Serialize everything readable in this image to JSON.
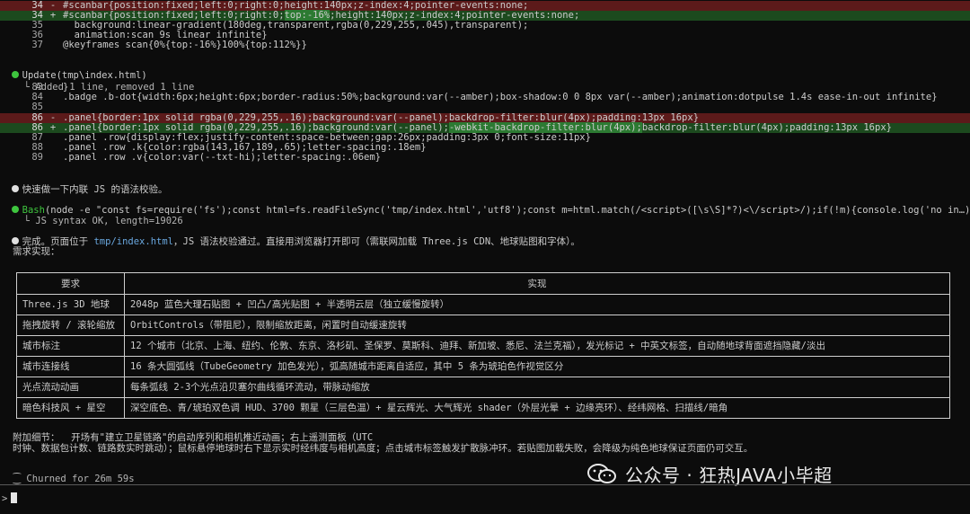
{
  "diff1": [
    {
      "num": "34",
      "sign": "-",
      "type": "del",
      "text": "#scanbar{position:fixed;left:0;right:0;height:140px;z-index:4;pointer-events:none;"
    },
    {
      "num": "34",
      "sign": "+",
      "type": "add",
      "pre": "#scanbar{position:fixed;left:0;right:0;",
      "hl": "top:-16%",
      "post": ";height:140px;z-index:4;pointer-events:none;"
    },
    {
      "num": "35",
      "sign": "",
      "type": "ctx",
      "text": "  background:linear-gradient(180deg,transparent,rgba(0,229,255,.045),transparent);"
    },
    {
      "num": "36",
      "sign": "",
      "type": "ctx",
      "text": "  animation:scan 9s linear infinite}"
    },
    {
      "num": "37",
      "sign": "",
      "type": "ctx",
      "text": "@keyframes scan{0%{top:-16%}100%{top:112%}}"
    }
  ],
  "update": {
    "title": "Update(tmp\\index.html)",
    "summary": "Added 1 line, removed 1 line"
  },
  "diff2": [
    {
      "num": "83",
      "sign": "",
      "type": "ctx",
      "text": "}"
    },
    {
      "num": "84",
      "sign": "",
      "type": "ctx",
      "text": ".badge .b-dot{width:6px;height:6px;border-radius:50%;background:var(--amber);box-shadow:0 0 8px var(--amber);animation:dotpulse 1.4s ease-in-out infinite}"
    },
    {
      "num": "85",
      "sign": "",
      "type": "ctx",
      "text": ""
    },
    {
      "num": "86",
      "sign": "-",
      "type": "del",
      "text": ".panel{border:1px solid rgba(0,229,255,.16);background:var(--panel);backdrop-filter:blur(4px);padding:13px 16px}"
    },
    {
      "num": "86",
      "sign": "+",
      "type": "add",
      "pre": ".panel{border:1px solid rgba(0,229,255,.16);background:var(--panel);",
      "hl": "-webkit-backdrop-filter:blur(4px);",
      "post": "backdrop-filter:blur(4px);padding:13px 16px}"
    },
    {
      "num": "87",
      "sign": "",
      "type": "ctx",
      "text": ".panel .row{display:flex;justify-content:space-between;gap:26px;padding:3px 0;font-size:11px}"
    },
    {
      "num": "88",
      "sign": "",
      "type": "ctx",
      "text": ".panel .row .k{color:rgba(143,167,189,.65);letter-spacing:.18em}"
    },
    {
      "num": "89",
      "sign": "",
      "type": "ctx",
      "text": ".panel .row .v{color:var(--txt-hi);letter-spacing:.06em}"
    }
  ],
  "msg_js_check": "快速做一下内联 JS 的语法校验。",
  "bash": {
    "label": "Bash",
    "command": "(node -e \"const fs=require('fs');const html=fs.readFileSync('tmp/index.html','utf8');const m=html.match(/<script>([\\s\\S]*?)<\\/script>/);if(!m){console.log('no in…)",
    "output": "JS syntax OK, length=19026"
  },
  "done": {
    "pre": "完成。页面位于 ",
    "path": "tmp/index.html",
    "post": "，JS 语法校验通过。直接用浏览器打开即可（需联网加载 Three.js CDN、地球贴图和字体）。"
  },
  "req_title": "需求实现：",
  "table": {
    "headers": [
      "要求",
      "实现"
    ],
    "rows": [
      [
        "Three.js 3D 地球",
        "2048p 蓝色大理石贴图 + 凹凸/高光贴图 + 半透明云层（独立缓慢旋转）"
      ],
      [
        "拖拽旋转 / 滚轮缩放",
        "OrbitControls（带阻尼），限制缩放距离，闲置时自动缓速旋转"
      ],
      [
        "城市标注",
        "12 个城市（北京、上海、纽约、伦敦、东京、洛杉矶、圣保罗、莫斯科、迪拜、新加坡、悉尼、法兰克福），发光标记 + 中英文标签，自动随地球背面遮挡隐藏/淡出"
      ],
      [
        "城市连接线",
        "16 条大圆弧线（TubeGeometry 加色发光），弧高随城市距离自适应，其中 5 条为琥珀色作视觉区分"
      ],
      [
        "光点流动动画",
        "每条弧线 2-3个光点沿贝塞尔曲线循环流动，带脉动缩放"
      ],
      [
        "暗色科技风 + 星空",
        "深空底色、青/琥珀双色调 HUD、3700 颗星（三层色温）+ 星云辉光、大气辉光 shader（外层光晕 + 边缘亮环）、经纬网格、扫描线/暗角"
      ]
    ]
  },
  "extra": {
    "line1": "附加细节：  开场有\"建立卫星链路\"的启动序列和相机推近动画；右上遥测面板（UTC",
    "line2": "时钟、数据包计数、链路数实时跳动）；鼠标悬停地球时右下显示实时经纬度与相机高度；点击城市标签触发扩散脉冲环。若贴图加载失败，会降级为纯色地球保证页面仍可交互。"
  },
  "churned": "Churned for 26m 59s",
  "prompt_symbol": ">",
  "watermark": "公众号 · 狂热JAVA小毕超",
  "colors": {
    "bg": "#0c0c0c",
    "del": "#5c1a1a",
    "add": "#1c4a1e",
    "del_hl": "#8c2828",
    "add_hl": "#2c7a32",
    "bullet_green": "#3ec53e",
    "link": "#6aa8e0"
  }
}
